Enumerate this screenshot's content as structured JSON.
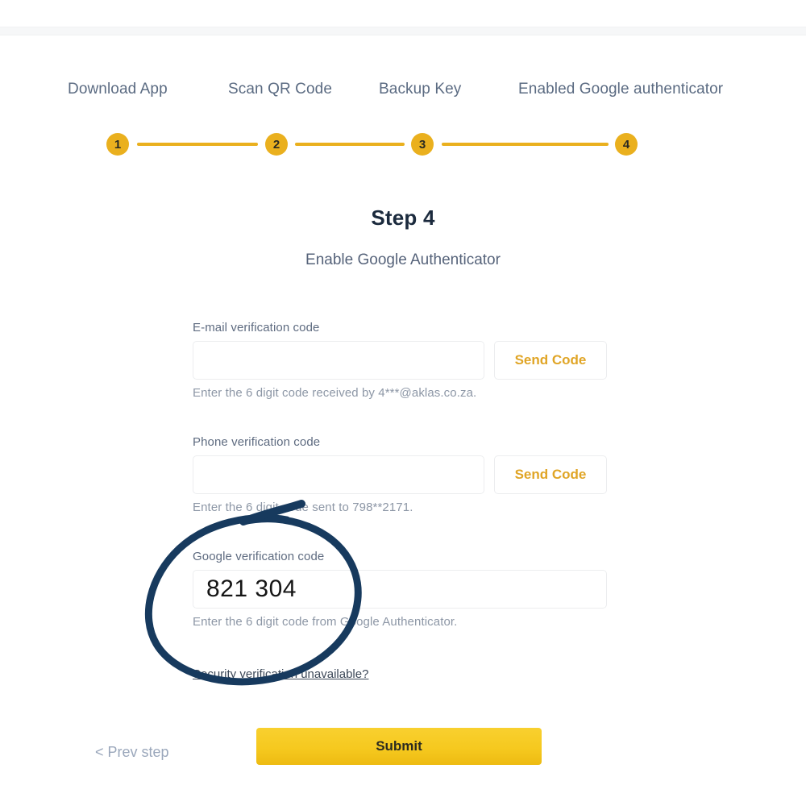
{
  "stepper": {
    "steps": [
      {
        "number": "1",
        "label": "Download App"
      },
      {
        "number": "2",
        "label": "Scan QR Code"
      },
      {
        "number": "3",
        "label": "Backup Key"
      },
      {
        "number": "4",
        "label": "Enabled Google authenticator"
      }
    ],
    "accent_color": "#eab01e"
  },
  "header": {
    "title": "Step 4",
    "subtitle": "Enable Google Authenticator"
  },
  "form": {
    "email_field": {
      "label": "E-mail verification code",
      "value": "",
      "placeholder": "",
      "button_label": "Send Code",
      "hint": "Enter the 6 digit code received by 4***@aklas.co.za."
    },
    "phone_field": {
      "label": "Phone verification code",
      "value": "",
      "placeholder": "",
      "button_label": "Send Code",
      "hint": "Enter the 6 digit code sent to 798**2171."
    },
    "google_field": {
      "label": "Google verification code",
      "value": "821 304",
      "placeholder": "",
      "hint": "Enter the 6 digit code from Google Authenticator."
    },
    "help_link": "Security verification unavailable?"
  },
  "footer": {
    "prev_label": "< Prev step",
    "submit_label": "Submit",
    "submit_color": "#f6c91f"
  },
  "annotation": {
    "shape": "hand-drawn-ellipse",
    "color": "#173a5e",
    "target": "google-verification-code-field"
  }
}
